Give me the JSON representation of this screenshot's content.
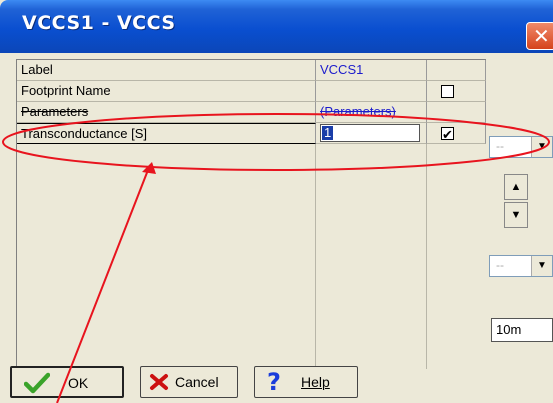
{
  "window": {
    "title": "VCCS1 - VCCS",
    "close_label": "x"
  },
  "grid": {
    "rows": [
      {
        "label": "Label",
        "value": "VCCS1",
        "checkbox": "none"
      },
      {
        "label": "Footprint Name",
        "value": "",
        "checkbox": "unchecked"
      },
      {
        "label": "Parameters",
        "value": "(Parameters)",
        "checkbox": "none"
      },
      {
        "label": "Transconductance [S]",
        "value": "1",
        "checkbox": "checked"
      }
    ],
    "check_mark": "✔"
  },
  "right_panel": {
    "combo1_text": "--",
    "combo2_text": "--",
    "spin_up": "▲",
    "spin_down": "▼",
    "dropdown_arrow": "▼",
    "field_value": "10m"
  },
  "buttons": {
    "ok_label": "OK",
    "cancel_label": "Cancel",
    "help_label": "Help",
    "help_glyph": "?"
  },
  "colors": {
    "title_bar": "#0a4fd0",
    "value_text": "#1c1ccc",
    "annotation": "#e8141e",
    "ok_check": "#3aa32a",
    "cancel_x": "#cc1111",
    "help_q": "#1a3ddb"
  }
}
